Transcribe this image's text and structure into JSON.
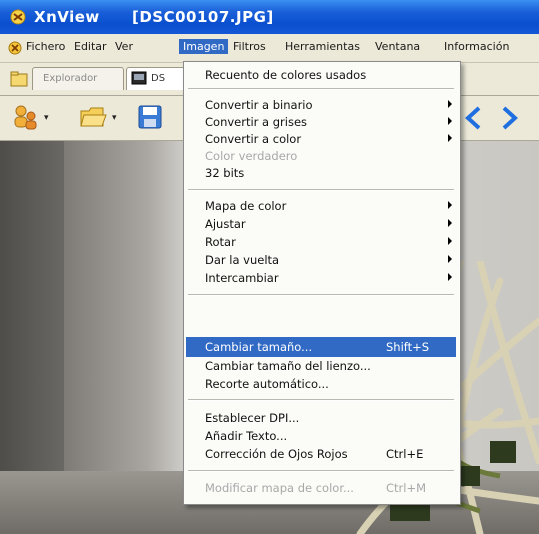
{
  "titlebar": {
    "app_name": "XnView",
    "file_name": "[DSC00107.JPG]"
  },
  "menubar": {
    "items": [
      {
        "label": "Fichero"
      },
      {
        "label": "Editar"
      },
      {
        "label": "Ver"
      },
      {
        "label": "Imagen"
      },
      {
        "label": "Filtros"
      },
      {
        "label": "Herramientas"
      },
      {
        "label": "Ventana"
      },
      {
        "label": "Información"
      }
    ],
    "active_item": "Imagen"
  },
  "tabs": [
    {
      "label": "Explorador",
      "icon": "folder-icon"
    },
    {
      "label": "DS",
      "icon": "image-icon"
    }
  ],
  "toolbar": {
    "icons": [
      "users-icon",
      "folder-open-icon",
      "save-icon",
      "previous-icon",
      "next-icon"
    ]
  },
  "image_menu": {
    "items": [
      {
        "label": "Recuento de colores usados"
      },
      {
        "label": "Convertir a binario",
        "submenu": true
      },
      {
        "label": "Convertir a grises",
        "submenu": true
      },
      {
        "label": "Convertir a color",
        "submenu": true
      },
      {
        "label": "Color verdadero",
        "disabled": true
      },
      {
        "label": "32 bits"
      },
      {
        "label": "Mapa de color",
        "submenu": true
      },
      {
        "label": "Ajustar",
        "submenu": true
      },
      {
        "label": "Rotar",
        "submenu": true
      },
      {
        "label": "Dar la vuelta",
        "submenu": true
      },
      {
        "label": "Intercambiar",
        "submenu": true
      },
      {
        "label": "Cambiar tamaño...",
        "shortcut": "Shift+S",
        "highlighted": true
      },
      {
        "label": "Cambiar tamaño del lienzo..."
      },
      {
        "label": "Recorte automático..."
      },
      {
        "label": "Establecer DPI..."
      },
      {
        "label": "Añadir Texto..."
      },
      {
        "label": "Corrección de Ojos Rojos",
        "shortcut": "Ctrl+E"
      },
      {
        "label": "Modificar mapa de color...",
        "shortcut": "Ctrl+M",
        "disabled": true
      }
    ]
  },
  "colors": {
    "titlebar": "#0a4fcf",
    "menubar": "#ece9d8",
    "highlight": "#316ac5",
    "disabled_text": "#a8a8a8",
    "arrow": "#1f6fe0"
  }
}
